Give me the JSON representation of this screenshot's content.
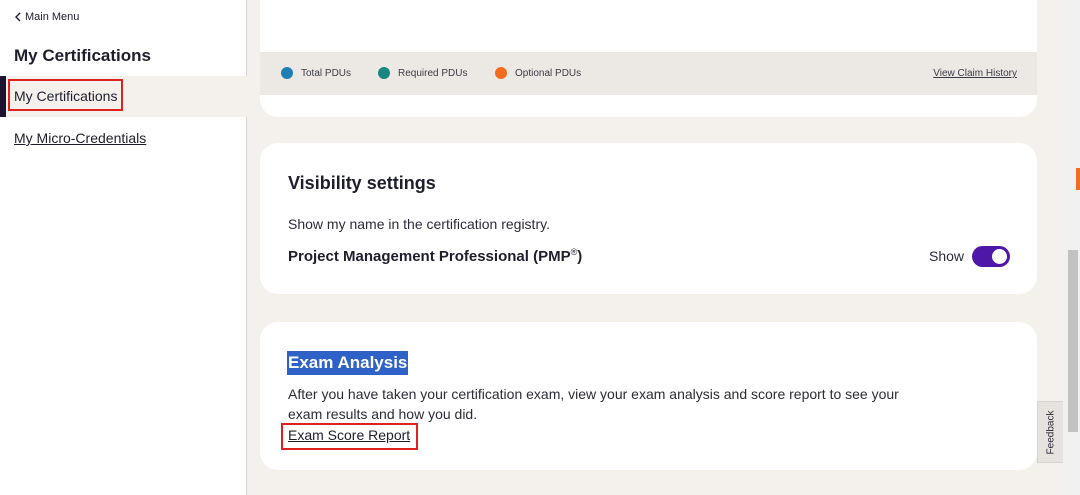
{
  "sidebar": {
    "main_menu": "Main Menu",
    "title": "My Certifications",
    "items": [
      {
        "label": "My Certifications",
        "active": true
      },
      {
        "label": "My Micro-Credentials",
        "active": false
      }
    ]
  },
  "pdu_card": {
    "legend": [
      {
        "label": "Total PDUs",
        "color": "#1f7fb4"
      },
      {
        "label": "Required PDUs",
        "color": "#1a8681"
      },
      {
        "label": "Optional PDUs",
        "color": "#f26c1f"
      }
    ],
    "claim_history": "View Claim History"
  },
  "visibility": {
    "title": "Visibility settings",
    "description": "Show my name in the certification registry.",
    "certification": "Project Management Professional (PMP",
    "certification_suffix": ")",
    "registered_mark": "®",
    "toggle_label": "Show",
    "toggle_on": true
  },
  "exam": {
    "title": "Exam Analysis",
    "description": "After you have taken your certification exam, view your exam analysis and score report to see your exam results and how you did.",
    "link": "Exam Score Report"
  },
  "feedback": "Feedback",
  "colors": {
    "accent": "#4f17a8",
    "highlight": "#2f62c6",
    "annotation": "#e0221e"
  }
}
